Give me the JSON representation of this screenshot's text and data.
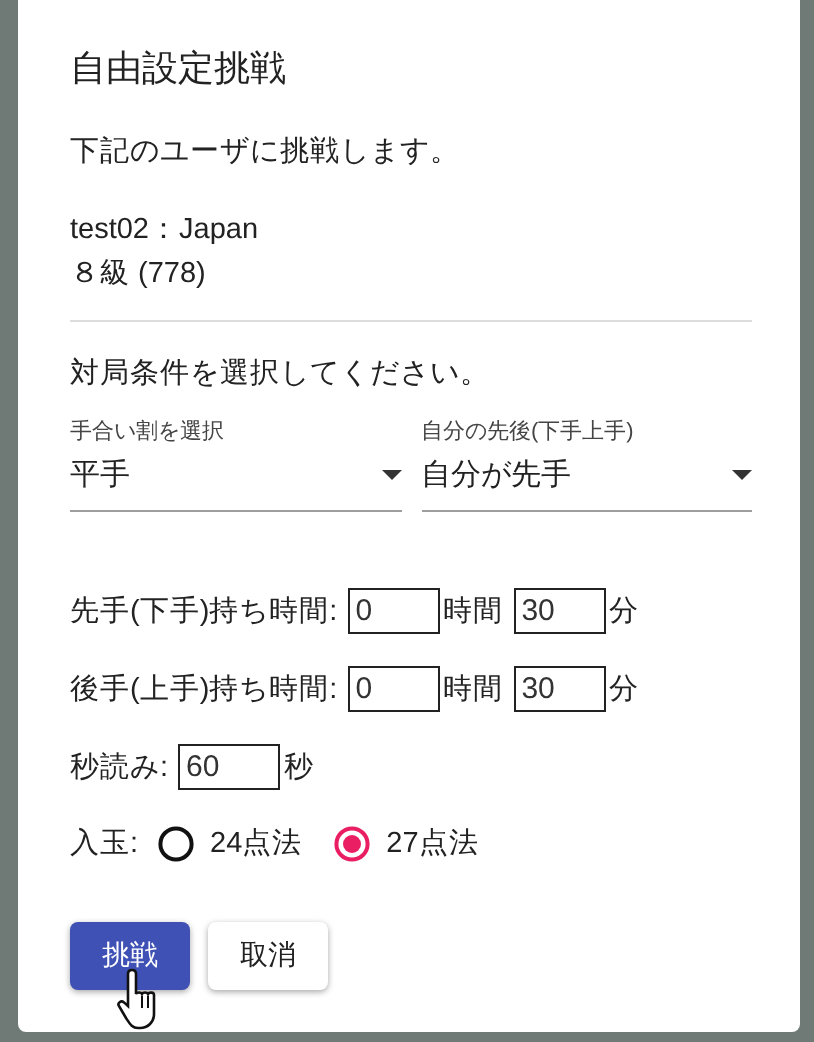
{
  "dialog": {
    "title": "自由設定挑戦",
    "intro": "下記のユーザに挑戦します。",
    "opponent": {
      "name_line": "test02：Japan",
      "rank_line": "８級 (778)"
    },
    "prompt": "対局条件を選択してください。",
    "selects": [
      {
        "label": "手合い割を選択",
        "value": "平手"
      },
      {
        "label": "自分の先後(下手上手)",
        "value": "自分が先手"
      }
    ],
    "time_rows": [
      {
        "label": "先手(下手)持ち時間:",
        "hours": "0",
        "hours_unit": "時間",
        "minutes": "30",
        "minutes_unit": "分"
      },
      {
        "label": "後手(上手)持ち時間:",
        "hours": "0",
        "hours_unit": "時間",
        "minutes": "30",
        "minutes_unit": "分"
      }
    ],
    "byoyomi": {
      "label": "秒読み:",
      "value": "60",
      "unit": "秒"
    },
    "nyugyoku": {
      "label": "入玉:",
      "options": [
        {
          "label": "24点法",
          "selected": false
        },
        {
          "label": "27点法",
          "selected": true
        }
      ]
    },
    "buttons": [
      {
        "label": "挑戦",
        "kind": "primary"
      },
      {
        "label": "取消",
        "kind": "secondary"
      }
    ]
  }
}
